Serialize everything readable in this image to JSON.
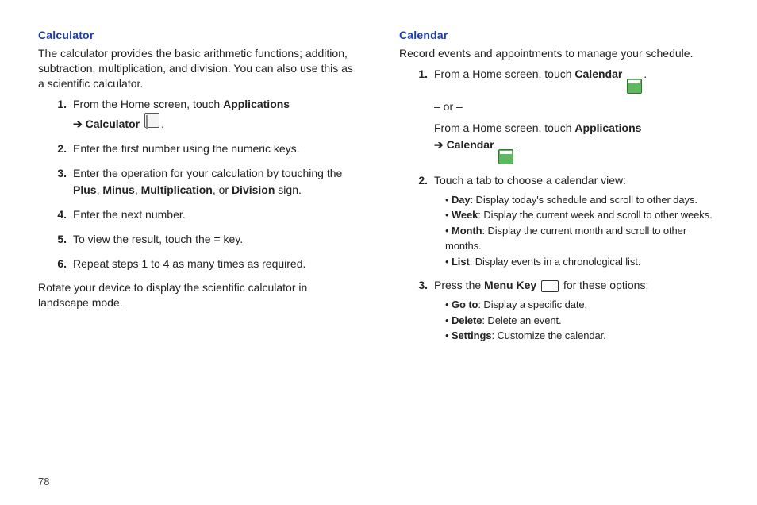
{
  "pageNumber": "78",
  "left": {
    "heading": "Calculator",
    "intro": "The calculator provides the basic arithmetic functions; addition, subtraction, multiplication, and division. You can also use this as a scientific calculator.",
    "steps": [
      {
        "num": "1.",
        "pre": "From the Home screen, touch ",
        "b1": "Applications",
        "mid": " ",
        "hasApps": true,
        "line2arrow": true,
        "l2b": "Calculator",
        "hasCalc": true,
        "after": "."
      },
      {
        "num": "2.",
        "text": "Enter the first number using the numeric keys."
      },
      {
        "num": "3.",
        "pre": "Enter the operation for your calculation by touching the ",
        "b1": "Plus",
        "c1": ", ",
        "b2": "Minus",
        "c2": ", ",
        "b3": "Multiplication",
        "c3": ", or ",
        "b4": "Division",
        "after": " sign."
      },
      {
        "num": "4.",
        "text": "Enter the next number."
      },
      {
        "num": "5.",
        "text": "To view the result, touch the = key."
      },
      {
        "num": "6.",
        "text": "Repeat steps 1 to 4 as many times as required."
      }
    ],
    "outro": "Rotate your device to display the scientific calculator in landscape mode."
  },
  "right": {
    "heading": "Calendar",
    "intro": "Record events and appointments to manage your schedule.",
    "step1": {
      "num": "1.",
      "preA": "From a Home screen, touch ",
      "bA": "Calendar",
      "or": "– or –",
      "preB": "From a Home screen, touch ",
      "bB": "Applications",
      "line2arrow": true,
      "l2b": "Calendar",
      "after": "."
    },
    "step2": {
      "num": "2.",
      "text": "Touch a tab to choose a calendar view:",
      "bullets": [
        {
          "b": "Day",
          "t": ": Display today's schedule and scroll to other days."
        },
        {
          "b": "Week",
          "t": ": Display the current week and scroll to other weeks."
        },
        {
          "b": "Month",
          "t": ": Display the current month and scroll to other months."
        },
        {
          "b": "List",
          "t": ": Display events in a chronological list."
        }
      ]
    },
    "step3": {
      "num": "3.",
      "pre": "Press the ",
      "b": "Menu Key",
      "after": " for these options:",
      "bullets": [
        {
          "b": "Go to",
          "t": ": Display a specific date."
        },
        {
          "b": "Delete",
          "t": ": Delete an event."
        },
        {
          "b": "Settings",
          "t": ": Customize the calendar."
        }
      ]
    }
  }
}
